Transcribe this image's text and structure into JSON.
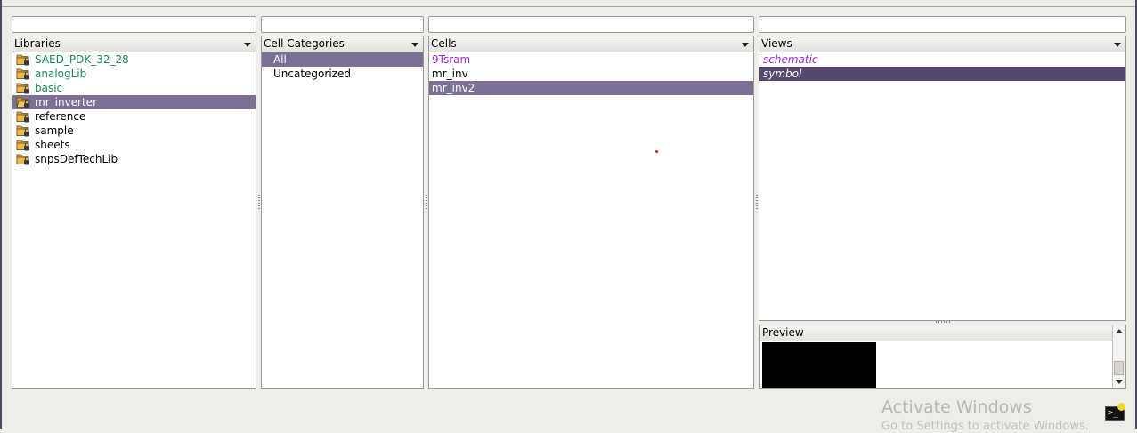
{
  "filters": {
    "libraries": "",
    "categories": "",
    "cells": "",
    "views": ""
  },
  "libraries": {
    "header": "Libraries",
    "items": [
      {
        "label": "SAED_PDK_32_28",
        "color": "green",
        "icon": "library-folder-icon"
      },
      {
        "label": "analogLib",
        "color": "green",
        "icon": "library-folder-icon"
      },
      {
        "label": "basic",
        "color": "green",
        "icon": "library-folder-icon"
      },
      {
        "label": "mr_inverter",
        "color": "black",
        "icon": "open-library-folder-icon",
        "selected": true
      },
      {
        "label": "reference",
        "color": "black",
        "icon": "library-folder-icon"
      },
      {
        "label": "sample",
        "color": "black",
        "icon": "library-folder-icon"
      },
      {
        "label": "sheets",
        "color": "black",
        "icon": "library-folder-icon"
      },
      {
        "label": "snpsDefTechLib",
        "color": "black",
        "icon": "library-folder-icon"
      }
    ]
  },
  "categories": {
    "header": "Cell Categories",
    "items": [
      {
        "label": "All",
        "selected": true
      },
      {
        "label": "Uncategorized"
      }
    ]
  },
  "cells": {
    "header": "Cells",
    "items": [
      {
        "label": "9Tsram",
        "color": "purple"
      },
      {
        "label": "mr_inv",
        "color": "black"
      },
      {
        "label": "mr_inv2",
        "color": "black",
        "selected": true
      }
    ]
  },
  "views": {
    "header": "Views",
    "items": [
      {
        "label": "schematic",
        "color": "purple"
      },
      {
        "label": "symbol",
        "selected": true
      }
    ]
  },
  "preview": {
    "header": "Preview"
  },
  "watermark": {
    "line1": "Activate Windows",
    "line2": "Go to Settings to activate Windows."
  },
  "colors": {
    "selection": "#7c7094",
    "selection_dark": "#56496f",
    "green": "#1a8a56",
    "purple": "#a32bd6"
  }
}
